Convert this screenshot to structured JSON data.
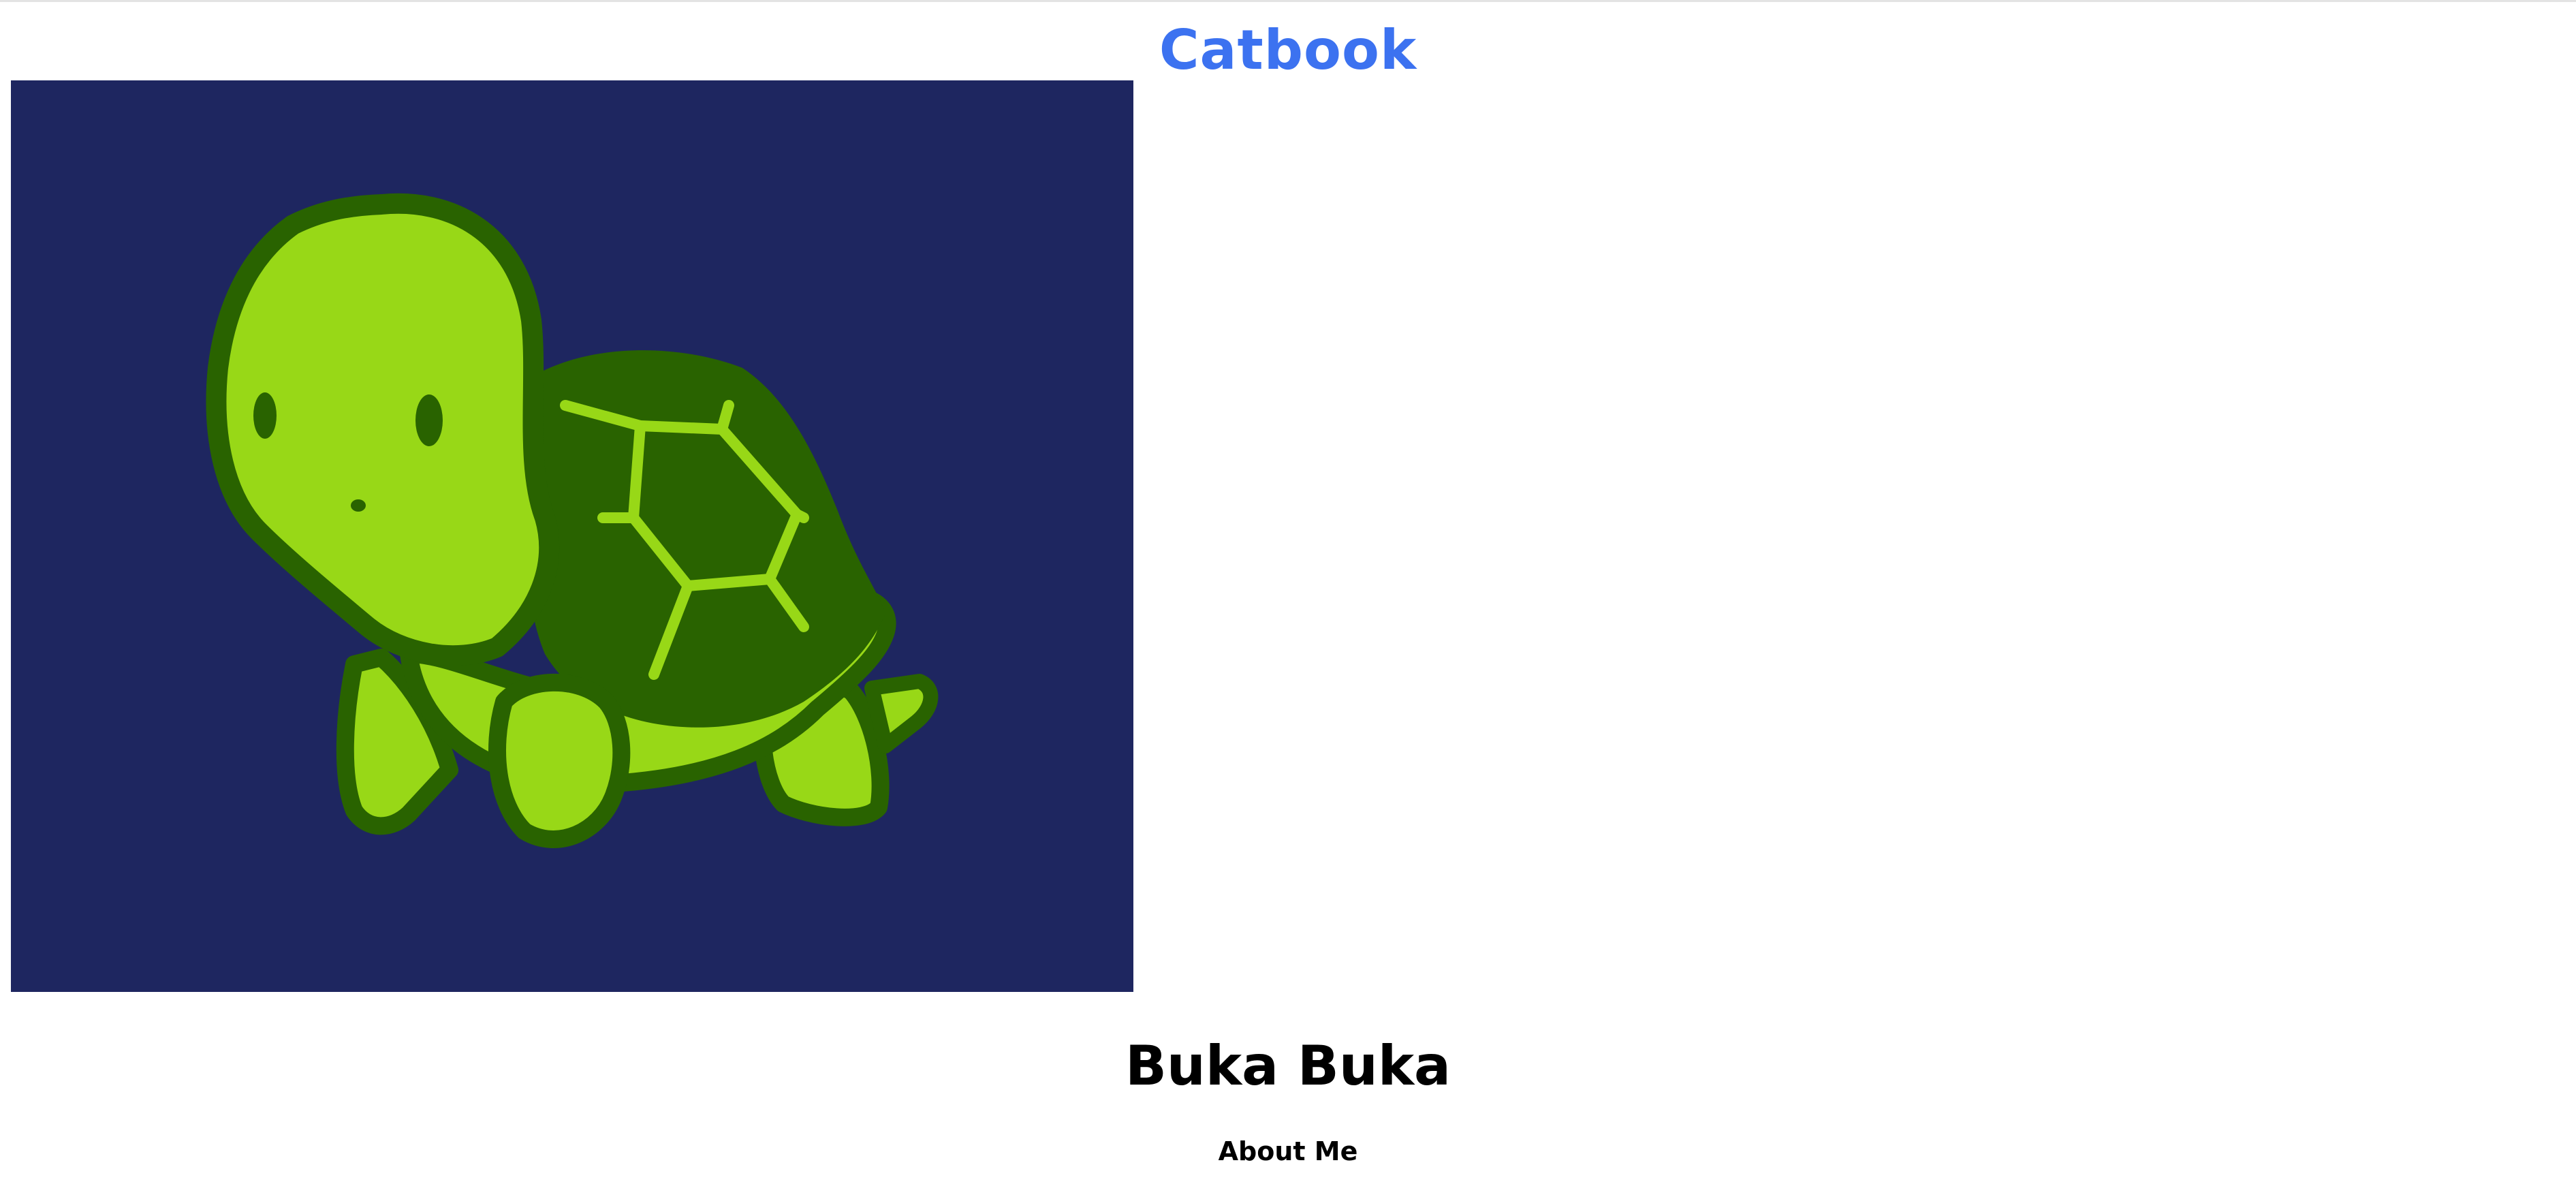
{
  "header": {
    "site_title": "Catbook"
  },
  "profile": {
    "name": "Buka Buka",
    "photo_icon": "turtle-image",
    "about_heading": "About Me"
  },
  "colors": {
    "title_blue": "#3c72f0",
    "photo_background": "#1e2660",
    "turtle_light_green": "#98d817",
    "turtle_dark_green": "#296300"
  }
}
